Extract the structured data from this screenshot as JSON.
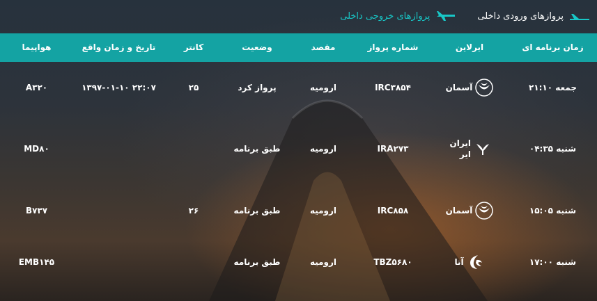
{
  "tabs": {
    "arrivals_label": "پروازهای ورودی داخلی",
    "departures_label": "پروازهای خروجی داخلی",
    "active_color": "#18c7c7"
  },
  "table": {
    "header_color": "#14a3a3",
    "columns": {
      "scheduled_time": "زمان برنامه ای",
      "airline": "ایرلاین",
      "flight_number": "شماره پرواز",
      "destination": "مقصد",
      "status": "وضعیت",
      "counter": "کانتر",
      "actual_time": "تاریخ و زمان واقع",
      "aircraft": "هواپیما"
    },
    "rows": [
      {
        "scheduled_time": "جمعه ۲۱:۱۰",
        "airline": "آسمان",
        "airline_icon": "aseman-logo-icon",
        "flight_number": "IRC۳۸۵۴",
        "destination": "ارومیه",
        "status": "پرواز کرد",
        "counter": "۲۵",
        "actual_time": "۱۳۹۷-۰۱-۱۰ ۲۲:۰۷",
        "aircraft": "A۳۲۰"
      },
      {
        "scheduled_time": "شنبه ۰۴:۳۵",
        "airline": "ایران ایر",
        "airline_icon": "iranair-logo-icon",
        "flight_number": "IRA۲۷۳",
        "destination": "ارومیه",
        "status": "طبق برنامه",
        "counter": "",
        "actual_time": "",
        "aircraft": "MD۸۰"
      },
      {
        "scheduled_time": "شنبه ۱۵:۰۵",
        "airline": "آسمان",
        "airline_icon": "aseman-logo-icon",
        "flight_number": "IRC۸۵۸",
        "destination": "ارومیه",
        "status": "طبق برنامه",
        "counter": "۲۶",
        "actual_time": "",
        "aircraft": "B۷۳۷"
      },
      {
        "scheduled_time": "شنبه ۱۷:۰۰",
        "airline": "آتا",
        "airline_icon": "ata-logo-icon",
        "flight_number": "TBZ۵۶۸۰",
        "destination": "ارومیه",
        "status": "طبق برنامه",
        "counter": "",
        "actual_time": "",
        "aircraft": "EMB۱۴۵"
      }
    ]
  }
}
